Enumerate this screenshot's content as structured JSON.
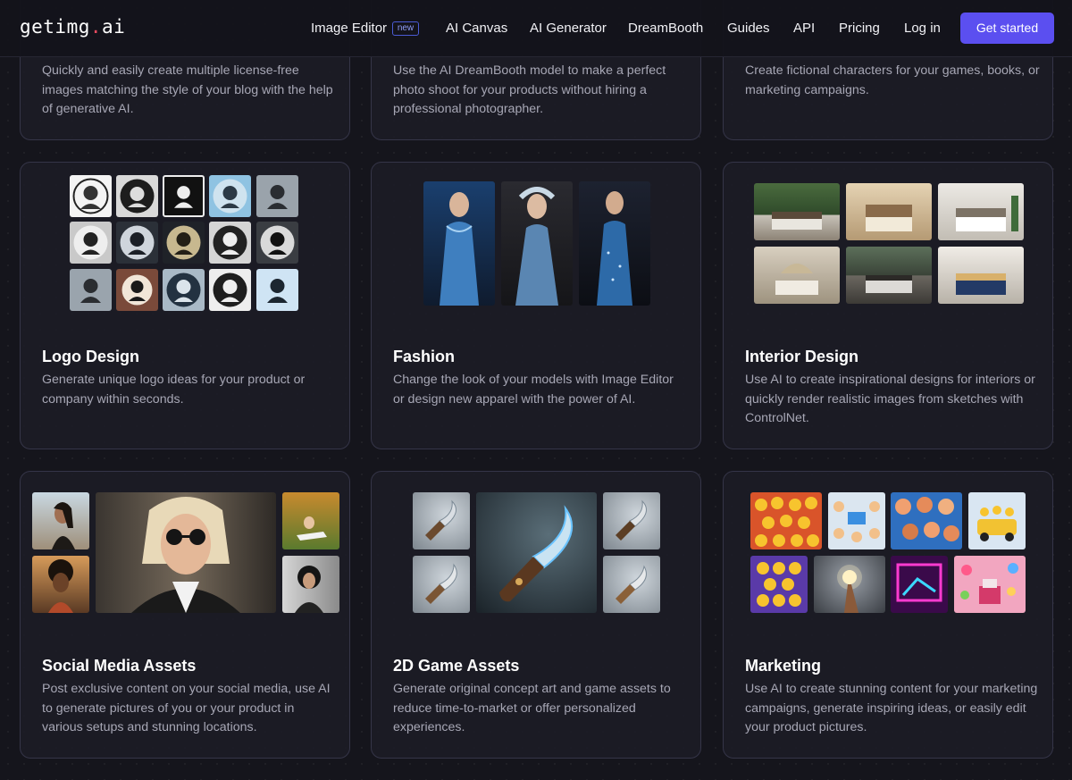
{
  "nav": {
    "logo_main": "getimg",
    "logo_dot": ".",
    "logo_ext": "ai",
    "links": [
      "Image Editor",
      "AI Canvas",
      "AI Generator",
      "DreamBooth",
      "Guides",
      "API",
      "Pricing",
      "Log in"
    ],
    "new_badge": "new",
    "cta": "Get started"
  },
  "cards_top": [
    {
      "desc": "Quickly and easily create multiple license-free images matching the style of your blog with the help of generative AI."
    },
    {
      "desc": "Use the AI DreamBooth model to make a perfect photo shoot for your products without hiring a professional photographer."
    },
    {
      "desc": "Create fictional characters for your games, books, or marketing campaigns."
    }
  ],
  "cards": [
    {
      "title": "Logo Design",
      "desc": "Generate unique logo ideas for your product or company within seconds."
    },
    {
      "title": "Fashion",
      "desc": "Change the look of your models with Image Editor or design new apparel with the power of AI."
    },
    {
      "title": "Interior Design",
      "desc": "Use AI to create inspirational designs for interiors or quickly render realistic images from sketches with ControlNet."
    },
    {
      "title": "Social Media Assets",
      "desc": "Post exclusive content on your social media, use AI to generate pictures of you or your product in various setups and stunning locations."
    },
    {
      "title": "2D Game Assets",
      "desc": "Generate original concept art and game assets to reduce time-to-market or offer personalized experiences."
    },
    {
      "title": "Marketing",
      "desc": "Use AI to create stunning content for your marketing campaigns, generate inspiring ideas, or easily edit your product pictures."
    }
  ],
  "colors": {
    "accent": "#5b4ff0",
    "background": "#15151c",
    "card_border": "#353548",
    "text_muted": "#a7a7b5"
  }
}
